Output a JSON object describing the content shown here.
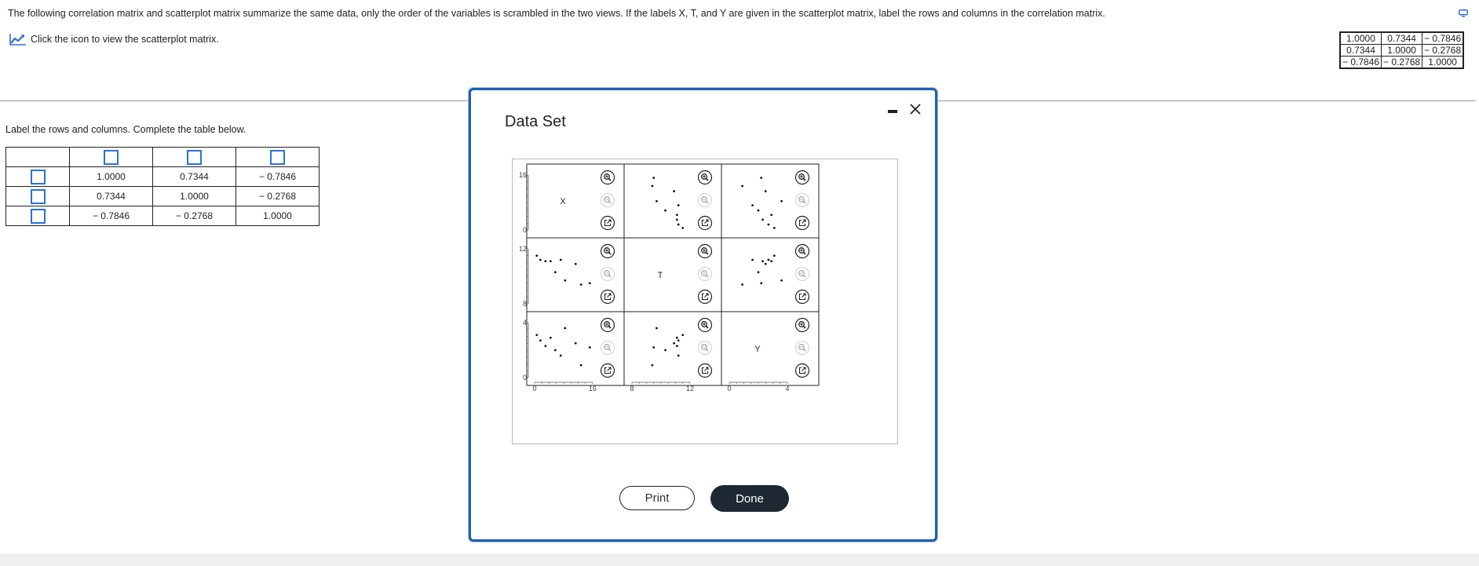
{
  "instructions": "The following correlation matrix and scatterplot matrix summarize the same data, only the order of the variables is scrambled in the two views. If the labels X, T, and Y are given in the scatterplot matrix, label the rows and columns in the correlation matrix.",
  "icon_link": {
    "label": "Click the icon to view the scatterplot matrix.",
    "icon": "line-chart-icon"
  },
  "corner_matrix": [
    [
      "1.0000",
      "0.7344",
      "− 0.7846"
    ],
    [
      "0.7344",
      "1.0000",
      "− 0.2768"
    ],
    [
      "− 0.7846",
      "− 0.2768",
      "1.0000"
    ]
  ],
  "table_label": "Label the rows and columns. Complete the table below.",
  "corr_matrix": [
    [
      "1.0000",
      "0.7344",
      "− 0.7846"
    ],
    [
      "0.7344",
      "1.0000",
      "− 0.2768"
    ],
    [
      "− 0.7846",
      "− 0.2768",
      "1.0000"
    ]
  ],
  "modal": {
    "title": "Data Set",
    "print_label": "Print",
    "done_label": "Done",
    "icons": [
      "minimize-icon",
      "close-icon",
      "zoom-in-icon",
      "zoom-out-icon",
      "pop-out-icon"
    ]
  },
  "colors": {
    "accent": "#2b72d6",
    "modal_border": "#1f5fb0",
    "done_bg": "#1d2833"
  },
  "chart_data": {
    "type": "scatter",
    "variables": [
      "X",
      "T",
      "Y"
    ],
    "axes": {
      "X": {
        "range": [
          0,
          16
        ],
        "ticks": [
          "0",
          "16"
        ]
      },
      "T": {
        "range": [
          8,
          12
        ],
        "ticks": [
          "8",
          "12"
        ]
      },
      "Y": {
        "range": [
          0,
          4
        ],
        "ticks": [
          "0",
          "4"
        ]
      }
    },
    "points": {
      "X": [
        0.6,
        1.6,
        3.0,
        4.4,
        5.7,
        7.2,
        8.4,
        11.3,
        12.8,
        15.2
      ],
      "T": [
        11.5,
        11.2,
        11.1,
        11.1,
        10.3,
        11.2,
        9.7,
        10.9,
        9.4,
        9.5
      ],
      "Y": [
        3.1,
        2.7,
        2.3,
        2.9,
        2.0,
        1.6,
        3.6,
        2.5,
        0.9,
        2.2
      ]
    }
  }
}
